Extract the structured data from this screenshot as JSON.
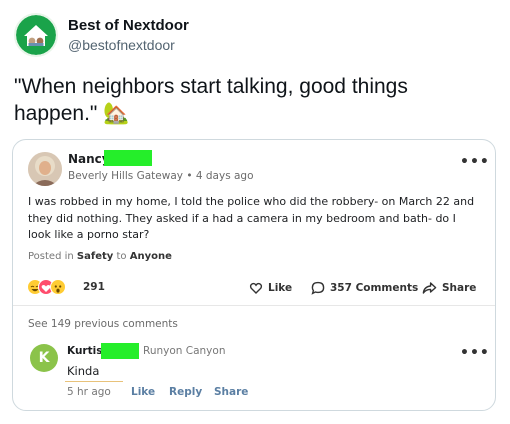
{
  "tweet": {
    "display_name": "Best of Nextdoor",
    "handle": "@bestofnextdoor",
    "text": "\"When neighbors start talking, good things happen.\"",
    "emoji": "🏡"
  },
  "post": {
    "author_first_name": "Nancy",
    "neighborhood": "Beverly Hills Gateway",
    "time_ago": "4 days ago",
    "sub_separator": "•",
    "body": "I was robbed in my home, I told the police who did the robbery- on March 22 and they did nothing. They asked if a had a camera in my bedroom and bath- do I look like a porno star?",
    "posted_in_prefix": "Posted in",
    "category": "Safety",
    "to_word": "to",
    "audience": "Anyone",
    "reaction_count": "291",
    "like_label": "Like",
    "comments_label": "357 Comments",
    "share_label": "Share",
    "see_previous": "See 149 previous comments",
    "more_glyph": "•••"
  },
  "comment": {
    "avatar_letter": "K",
    "author_first_name": "Kurtis",
    "neighborhood": "Runyon Canyon",
    "text": "Kinda",
    "time_ago": "5 hr ago",
    "like_label": "Like",
    "reply_label": "Reply",
    "share_label": "Share",
    "more_glyph": "•••"
  },
  "colors": {
    "redaction": "#25ee2a",
    "k_avatar": "#8bc34a"
  }
}
